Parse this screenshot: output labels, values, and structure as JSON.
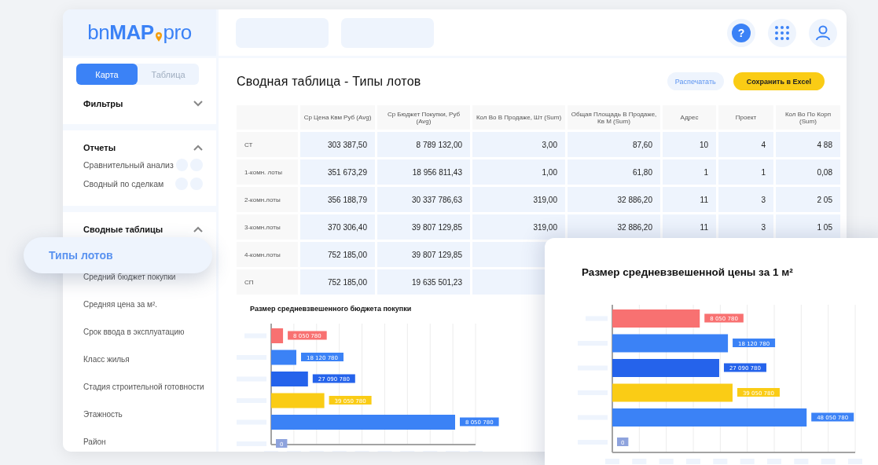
{
  "header": {
    "logo": {
      "part_1": "bn",
      "part_2": "MAP",
      "part_3": "pro"
    },
    "help_button": "?"
  },
  "sidebar": {
    "view_tabs": [
      {
        "label": "Карта",
        "selected": true
      },
      {
        "label": "Таблица",
        "selected": false
      }
    ],
    "sections": [
      {
        "title": "Фильтры",
        "expanded": false
      },
      {
        "title": "Отчеты",
        "expanded": true,
        "kind": "reports",
        "items": [
          {
            "label": "Сравнительный анализ",
            "selected": false
          },
          {
            "label": "Сводный по сделкам",
            "selected": false
          }
        ]
      },
      {
        "title": "Сводные таблицы",
        "expanded": true,
        "kind": "list",
        "items": [
          {
            "label": "Типы лотов",
            "selected": true
          },
          {
            "label": "Средний бюджет покупки",
            "selected": false
          },
          {
            "label": "Средняя цена за м².",
            "selected": false
          },
          {
            "label": "Срок ввода в эксплуатацию",
            "selected": false
          },
          {
            "label": "Класс жилья",
            "selected": false
          },
          {
            "label": "Стадия строительной готовности",
            "selected": false
          },
          {
            "label": "Этажность",
            "selected": false
          },
          {
            "label": "Район",
            "selected": false
          }
        ]
      }
    ]
  },
  "page": {
    "title": "Сводная таблица - Типы лотов",
    "buttons": [
      {
        "label": "Распечатать",
        "kind": "secondary"
      },
      {
        "label": "Сохранить в Excel",
        "kind": "primary"
      }
    ]
  },
  "table": {
    "columns": [
      "",
      "Ср Цена Квм Руб (Avg)",
      "Ср Бюджет Покупки, Руб (Avg)",
      "Кол Во В Продаже, Шт (Sum)",
      "Общая Площадь В Продаже, Кв М (Sum)",
      "Адрес",
      "Проект",
      "Кол Во По Корп (Sum)"
    ],
    "rows": [
      [
        "СТ",
        "303 387,50",
        "8 789 132,00",
        "3,00",
        "87,60",
        "10",
        "4",
        "4 88"
      ],
      [
        "1-комн. лоты",
        "351 673,29",
        "18 956 811,43",
        "1,00",
        "61,80",
        "1",
        "1",
        "0,08"
      ],
      [
        "2-комн.лоты",
        "356 188,79",
        "30 337 786,63",
        "319,00",
        "32 886,20",
        "11",
        "3",
        "2 05"
      ],
      [
        "3-комн.лоты",
        "370 306,40",
        "39 807 129,85",
        "319,00",
        "32 886,20",
        "11",
        "3",
        "1 05"
      ],
      [
        "4-комн.лоты",
        "752 185,00",
        "39 807 129,85"
      ],
      [
        "СП",
        "752 185,00",
        "19 635 501,23"
      ]
    ]
  },
  "charts": [
    {
      "title": "Размер средневзвешенного бюджета покупки",
      "bars": [
        {
          "label": "8 050 780",
          "color": "#f87171"
        },
        {
          "label": "18 120 780",
          "color": "#3b82f6"
        },
        {
          "label": "27 090 780",
          "color": "#2563eb"
        },
        {
          "label": "39 050 780",
          "color": "#facc15"
        },
        {
          "label": "8 050 780",
          "color": "#3b82f6"
        },
        {
          "label": "0",
          "color": "#8ea3dd"
        }
      ]
    },
    {
      "title": "Размер средневзвешенной цены за 1 м²",
      "bars": [
        {
          "label": "8 050 780",
          "color": "#f87171"
        },
        {
          "label": "18 120 780",
          "color": "#3b82f6"
        },
        {
          "label": "27 090 780",
          "color": "#2563eb"
        },
        {
          "label": "39 050 780",
          "color": "#facc15"
        },
        {
          "label": "48 050 780",
          "color": "#3b82f6"
        },
        {
          "label": "0",
          "color": "#8ea3dd"
        }
      ]
    }
  ]
}
